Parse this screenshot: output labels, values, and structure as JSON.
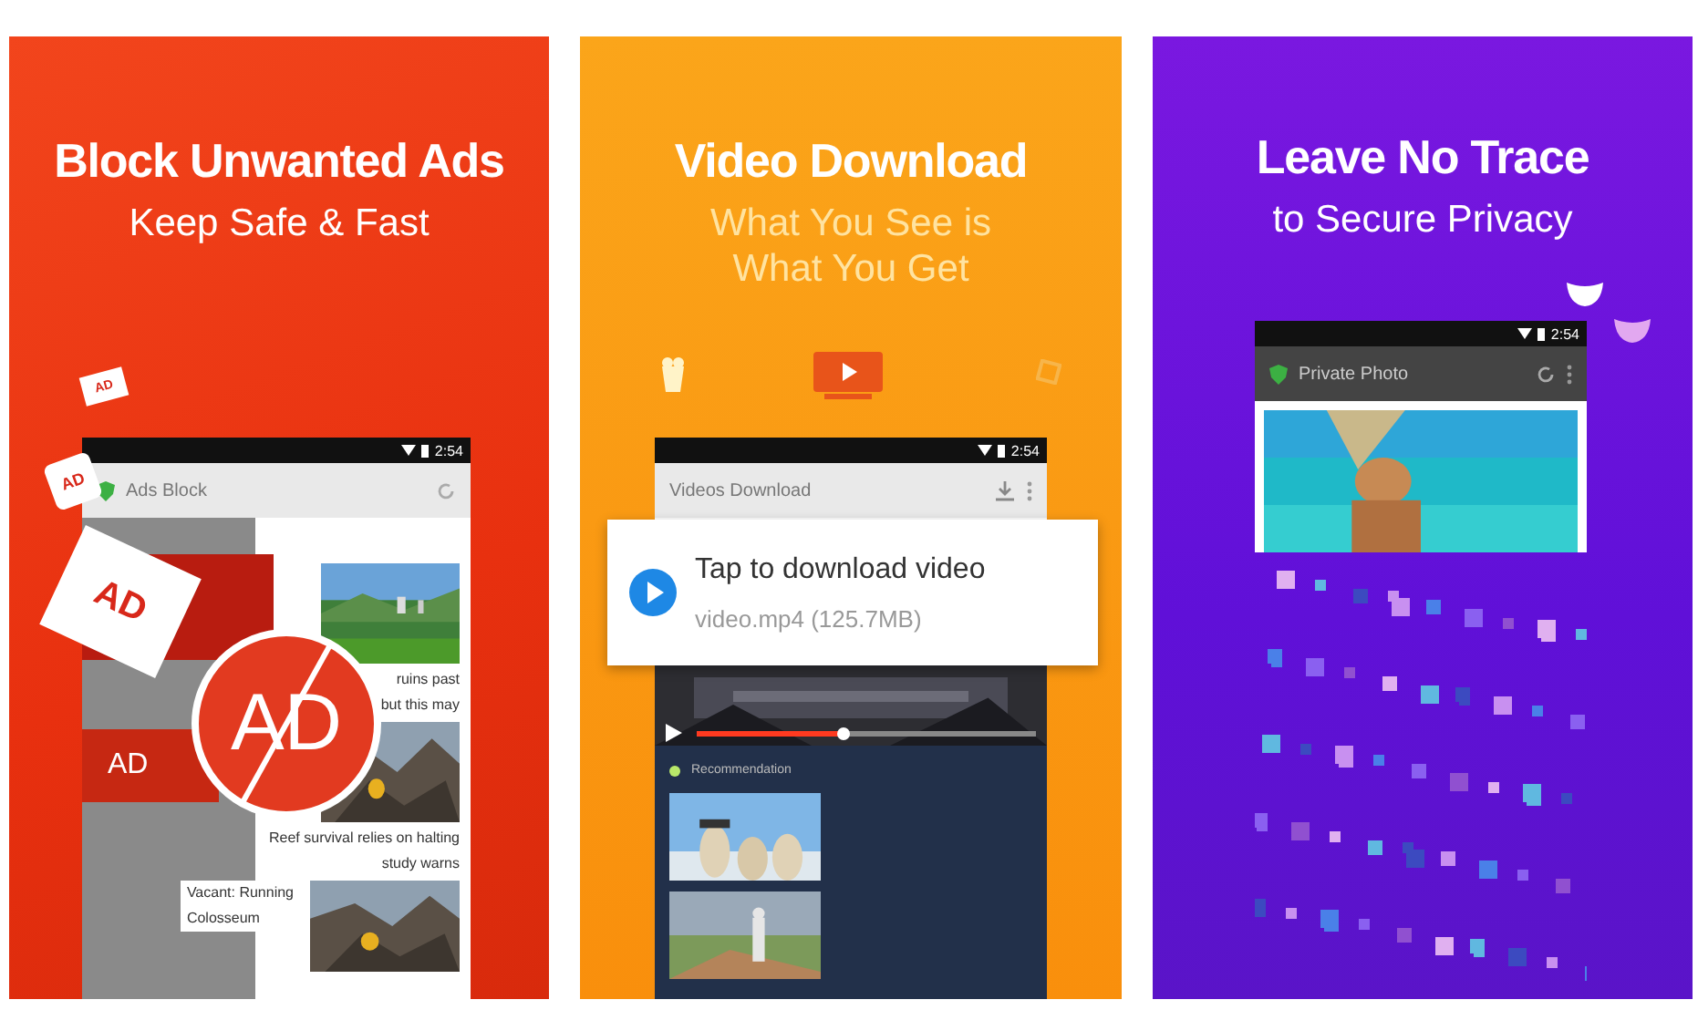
{
  "panels": [
    {
      "kind": "ads",
      "title": "Block Unwanted Ads",
      "subtitles": [
        "Keep Safe & Fast"
      ],
      "phone": {
        "time": "2:54",
        "app_title": "Ads Block"
      },
      "ad_labels": [
        "AD",
        "AD",
        "AD",
        "AD",
        "AD"
      ],
      "articles": [
        {
          "lines": [
            "ruins past",
            "but this may"
          ]
        },
        {
          "lines": [
            "Reef survival relies on halting",
            "study warns"
          ]
        },
        {
          "lines": [
            "Vacant: Running",
            "Colosseum"
          ]
        }
      ]
    },
    {
      "kind": "video",
      "title": "Video Download",
      "subtitles": [
        "What You See is",
        "What You Get"
      ],
      "phone": {
        "time": "2:54",
        "app_title": "Videos Download"
      },
      "popup": {
        "title": "Tap to download video",
        "file": "video.mp4  (125.7MB)"
      },
      "player": {
        "level": 0.43
      },
      "section": "Recommendation"
    },
    {
      "kind": "privacy",
      "title": "Leave No Trace",
      "subtitles": [
        "to Secure Privacy"
      ],
      "phone": {
        "time": "2:54",
        "app_title": "Private Photo"
      }
    }
  ]
}
